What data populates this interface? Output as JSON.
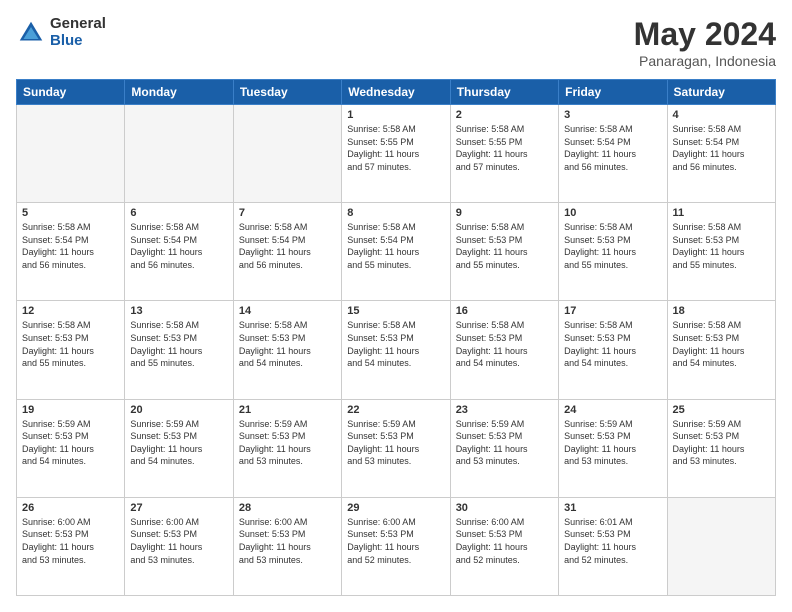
{
  "logo": {
    "general": "General",
    "blue": "Blue"
  },
  "title": "May 2024",
  "subtitle": "Panaragan, Indonesia",
  "weekdays": [
    "Sunday",
    "Monday",
    "Tuesday",
    "Wednesday",
    "Thursday",
    "Friday",
    "Saturday"
  ],
  "weeks": [
    [
      {
        "day": "",
        "info": ""
      },
      {
        "day": "",
        "info": ""
      },
      {
        "day": "",
        "info": ""
      },
      {
        "day": "1",
        "info": "Sunrise: 5:58 AM\nSunset: 5:55 PM\nDaylight: 11 hours\nand 57 minutes."
      },
      {
        "day": "2",
        "info": "Sunrise: 5:58 AM\nSunset: 5:55 PM\nDaylight: 11 hours\nand 57 minutes."
      },
      {
        "day": "3",
        "info": "Sunrise: 5:58 AM\nSunset: 5:54 PM\nDaylight: 11 hours\nand 56 minutes."
      },
      {
        "day": "4",
        "info": "Sunrise: 5:58 AM\nSunset: 5:54 PM\nDaylight: 11 hours\nand 56 minutes."
      }
    ],
    [
      {
        "day": "5",
        "info": "Sunrise: 5:58 AM\nSunset: 5:54 PM\nDaylight: 11 hours\nand 56 minutes."
      },
      {
        "day": "6",
        "info": "Sunrise: 5:58 AM\nSunset: 5:54 PM\nDaylight: 11 hours\nand 56 minutes."
      },
      {
        "day": "7",
        "info": "Sunrise: 5:58 AM\nSunset: 5:54 PM\nDaylight: 11 hours\nand 56 minutes."
      },
      {
        "day": "8",
        "info": "Sunrise: 5:58 AM\nSunset: 5:54 PM\nDaylight: 11 hours\nand 55 minutes."
      },
      {
        "day": "9",
        "info": "Sunrise: 5:58 AM\nSunset: 5:53 PM\nDaylight: 11 hours\nand 55 minutes."
      },
      {
        "day": "10",
        "info": "Sunrise: 5:58 AM\nSunset: 5:53 PM\nDaylight: 11 hours\nand 55 minutes."
      },
      {
        "day": "11",
        "info": "Sunrise: 5:58 AM\nSunset: 5:53 PM\nDaylight: 11 hours\nand 55 minutes."
      }
    ],
    [
      {
        "day": "12",
        "info": "Sunrise: 5:58 AM\nSunset: 5:53 PM\nDaylight: 11 hours\nand 55 minutes."
      },
      {
        "day": "13",
        "info": "Sunrise: 5:58 AM\nSunset: 5:53 PM\nDaylight: 11 hours\nand 55 minutes."
      },
      {
        "day": "14",
        "info": "Sunrise: 5:58 AM\nSunset: 5:53 PM\nDaylight: 11 hours\nand 54 minutes."
      },
      {
        "day": "15",
        "info": "Sunrise: 5:58 AM\nSunset: 5:53 PM\nDaylight: 11 hours\nand 54 minutes."
      },
      {
        "day": "16",
        "info": "Sunrise: 5:58 AM\nSunset: 5:53 PM\nDaylight: 11 hours\nand 54 minutes."
      },
      {
        "day": "17",
        "info": "Sunrise: 5:58 AM\nSunset: 5:53 PM\nDaylight: 11 hours\nand 54 minutes."
      },
      {
        "day": "18",
        "info": "Sunrise: 5:58 AM\nSunset: 5:53 PM\nDaylight: 11 hours\nand 54 minutes."
      }
    ],
    [
      {
        "day": "19",
        "info": "Sunrise: 5:59 AM\nSunset: 5:53 PM\nDaylight: 11 hours\nand 54 minutes."
      },
      {
        "day": "20",
        "info": "Sunrise: 5:59 AM\nSunset: 5:53 PM\nDaylight: 11 hours\nand 54 minutes."
      },
      {
        "day": "21",
        "info": "Sunrise: 5:59 AM\nSunset: 5:53 PM\nDaylight: 11 hours\nand 53 minutes."
      },
      {
        "day": "22",
        "info": "Sunrise: 5:59 AM\nSunset: 5:53 PM\nDaylight: 11 hours\nand 53 minutes."
      },
      {
        "day": "23",
        "info": "Sunrise: 5:59 AM\nSunset: 5:53 PM\nDaylight: 11 hours\nand 53 minutes."
      },
      {
        "day": "24",
        "info": "Sunrise: 5:59 AM\nSunset: 5:53 PM\nDaylight: 11 hours\nand 53 minutes."
      },
      {
        "day": "25",
        "info": "Sunrise: 5:59 AM\nSunset: 5:53 PM\nDaylight: 11 hours\nand 53 minutes."
      }
    ],
    [
      {
        "day": "26",
        "info": "Sunrise: 6:00 AM\nSunset: 5:53 PM\nDaylight: 11 hours\nand 53 minutes."
      },
      {
        "day": "27",
        "info": "Sunrise: 6:00 AM\nSunset: 5:53 PM\nDaylight: 11 hours\nand 53 minutes."
      },
      {
        "day": "28",
        "info": "Sunrise: 6:00 AM\nSunset: 5:53 PM\nDaylight: 11 hours\nand 53 minutes."
      },
      {
        "day": "29",
        "info": "Sunrise: 6:00 AM\nSunset: 5:53 PM\nDaylight: 11 hours\nand 52 minutes."
      },
      {
        "day": "30",
        "info": "Sunrise: 6:00 AM\nSunset: 5:53 PM\nDaylight: 11 hours\nand 52 minutes."
      },
      {
        "day": "31",
        "info": "Sunrise: 6:01 AM\nSunset: 5:53 PM\nDaylight: 11 hours\nand 52 minutes."
      },
      {
        "day": "",
        "info": ""
      }
    ]
  ]
}
